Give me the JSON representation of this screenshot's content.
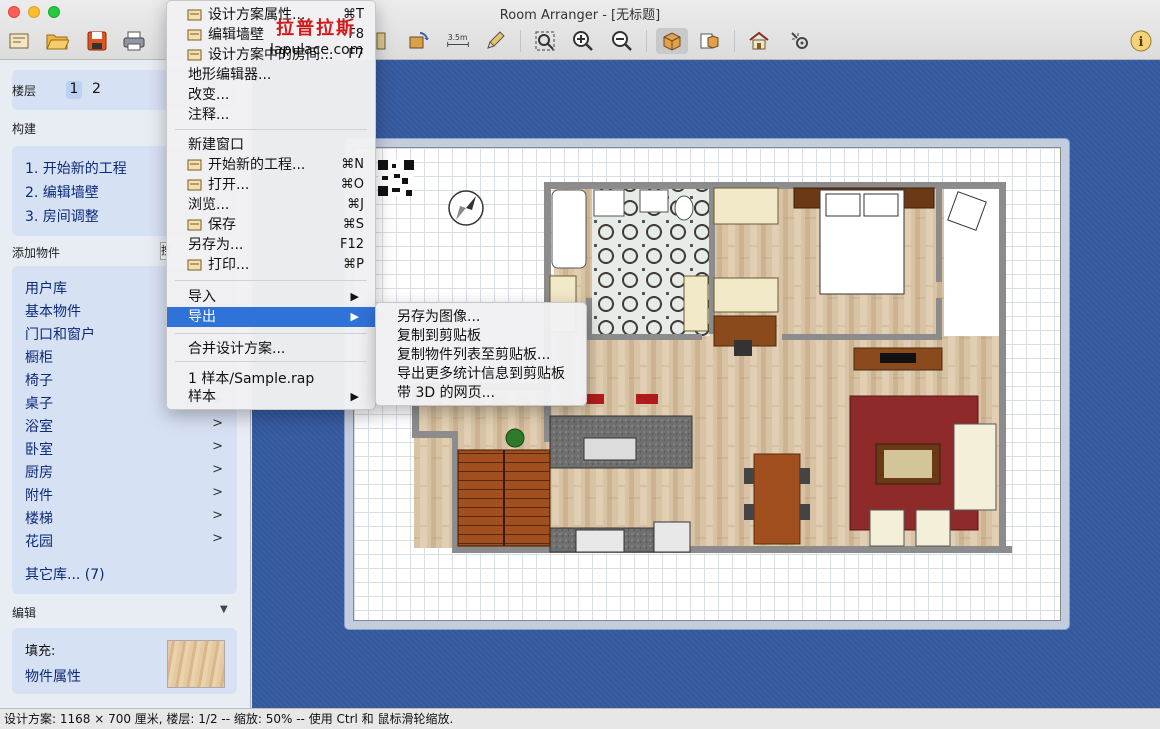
{
  "window": {
    "title": "Room Arranger - [无标题]"
  },
  "toolbar": {
    "icons": [
      "new-plan-icon",
      "open-folder-icon",
      "save-disk-icon",
      "print-icon",
      "wall-icon",
      "rotate-object-icon",
      "measure-icon",
      "pencil-icon",
      "zoom-fit-icon",
      "zoom-in-icon",
      "zoom-out-icon",
      "3d-box-icon",
      "3d-boxes-icon",
      "house-icon",
      "settings-icon",
      "info-icon"
    ],
    "measure_label": "3.5m"
  },
  "sidebar": {
    "floors_label": "楼层",
    "floors": [
      "1",
      "2"
    ],
    "build_label": "构建",
    "build_steps": [
      "1. 开始新的工程",
      "2. 编辑墙壁",
      "3. 房间调整"
    ],
    "add_objects_label": "添加物件",
    "add_objects_button": "搜",
    "library": [
      {
        "label": "用户库",
        "arrow": ""
      },
      {
        "label": "基本物件",
        "arrow": ""
      },
      {
        "label": "门口和窗户",
        "arrow": ""
      },
      {
        "label": "橱柜",
        "arrow": ""
      },
      {
        "label": "椅子",
        "arrow": ""
      },
      {
        "label": "桌子",
        "arrow": ">"
      },
      {
        "label": "浴室",
        "arrow": ">"
      },
      {
        "label": "卧室",
        "arrow": ">"
      },
      {
        "label": "厨房",
        "arrow": ">"
      },
      {
        "label": "附件",
        "arrow": ">"
      },
      {
        "label": "楼梯",
        "arrow": ">"
      },
      {
        "label": "花园",
        "arrow": ">"
      }
    ],
    "other_libraries": "其它库... (7)",
    "edit_label": "编辑",
    "edit_collapse": "▼",
    "fill_label": "填充:",
    "object_props": "物件属性"
  },
  "file_menu": {
    "items": [
      {
        "label": "设计方案属性...",
        "shortcut": "⌘T",
        "icon": "plan-props-icon"
      },
      {
        "label": "编辑墙壁",
        "shortcut": "F8",
        "icon": "wall-edit-icon"
      },
      {
        "label": "设计方案中的房间...",
        "shortcut": "F7",
        "icon": "rooms-icon"
      },
      {
        "label": "地形编辑器...",
        "shortcut": ""
      },
      {
        "label": "改变...",
        "shortcut": ""
      },
      {
        "label": "注释...",
        "shortcut": ""
      },
      {
        "label": "新建窗口",
        "shortcut": ""
      },
      {
        "label": "开始新的工程...",
        "shortcut": "⌘N",
        "icon": "new-project-icon"
      },
      {
        "label": "打开...",
        "shortcut": "⌘O",
        "icon": "open-folder-icon"
      },
      {
        "label": "浏览...",
        "shortcut": "⌘J"
      },
      {
        "label": "保存",
        "shortcut": "⌘S",
        "icon": "save-disk-icon"
      },
      {
        "label": "另存为...",
        "shortcut": "F12"
      },
      {
        "label": "打印...",
        "shortcut": "⌘P",
        "icon": "print-icon"
      },
      {
        "label": "导入",
        "shortcut": "▶"
      },
      {
        "label": "导出",
        "shortcut": "▶"
      },
      {
        "label": "合并设计方案...",
        "shortcut": ""
      },
      {
        "label": "1 样本/Sample.rap",
        "shortcut": ""
      },
      {
        "label": "样本",
        "shortcut": "▶"
      }
    ]
  },
  "export_submenu": {
    "items": [
      "另存为图像...",
      "复制到剪贴板",
      "复制物件列表至剪贴板...",
      "导出更多统计信息到剪贴板",
      "带 3D 的网页..."
    ]
  },
  "watermark": {
    "text": "拉普拉斯",
    "url": "lapulace.com"
  },
  "status": {
    "text": "设计方案: 1168 × 700 厘米, 楼层: 1/2 -- 缩放: 50% -- 使用 Ctrl 和 鼠标滑轮缩放."
  },
  "colors": {
    "accent": "#2f73d9",
    "sidebar_link": "#0b2a78",
    "canvas_bg": "#3a5ea3",
    "floor_wood": "#d8c3a4",
    "rug": "#8e2a2a",
    "stairs": "#a24f1f"
  }
}
